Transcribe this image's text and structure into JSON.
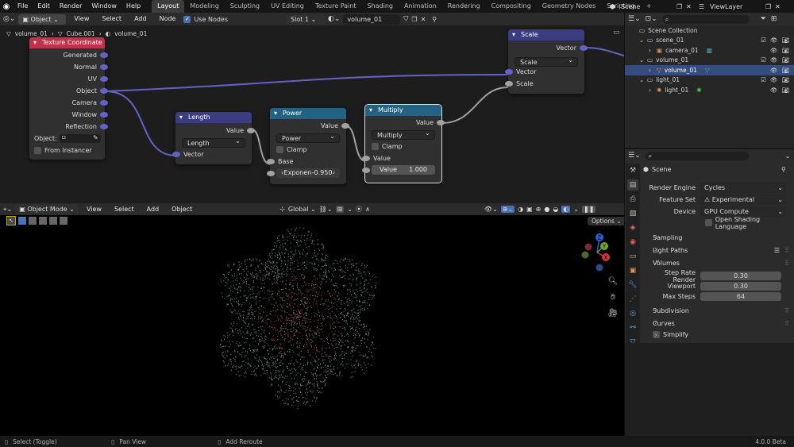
{
  "topbar": {
    "menus": [
      "File",
      "Edit",
      "Render",
      "Window",
      "Help"
    ],
    "workspaces": [
      "Layout",
      "Modeling",
      "Sculpting",
      "UV Editing",
      "Texture Paint",
      "Shading",
      "Animation",
      "Rendering",
      "Compositing",
      "Geometry Nodes",
      "Scripting"
    ],
    "active_workspace": "Layout",
    "add_tab": "+",
    "scene": "Scene",
    "view_layer": "ViewLayer"
  },
  "node_editor": {
    "mode": "Object",
    "menus": [
      "View",
      "Select",
      "Add",
      "Node"
    ],
    "use_nodes_label": "Use Nodes",
    "slot": "Slot 1",
    "material": "volume_01",
    "breadcrumb": [
      "volume_01",
      "Cube.001",
      "volume_01"
    ],
    "texcoord": {
      "title": "Texture Coordinate",
      "outputs": [
        "Generated",
        "Normal",
        "UV",
        "Object",
        "Camera",
        "Window",
        "Reflection"
      ],
      "object_label": "Object:",
      "from_instancer": "From Instancer"
    },
    "length": {
      "title": "Length",
      "output": "Value",
      "op": "Length",
      "input": "Vector"
    },
    "power": {
      "title": "Power",
      "output": "Value",
      "op": "Power",
      "clamp": "Clamp",
      "base": "Base",
      "exponent_label": "Exponen",
      "exponent_value": "-0.950"
    },
    "multiply": {
      "title": "Multiply",
      "output": "Value",
      "op": "Multiply",
      "clamp": "Clamp",
      "value_in": "Value",
      "value_label": "Value",
      "value_value": "1.000"
    },
    "scale": {
      "title": "Scale",
      "output": "Vector",
      "op": "Scale",
      "vector_in": "Vector",
      "scale_in": "Scale"
    }
  },
  "viewport": {
    "mode": "Object Mode",
    "menus": [
      "View",
      "Select",
      "Add",
      "Object"
    ],
    "orientation": "Global",
    "options": "Options",
    "gizmo": {
      "x": "X",
      "y": "Y",
      "z": "Z"
    }
  },
  "outliner": {
    "title": "Scene Collection",
    "items": [
      {
        "name": "scene_01",
        "indent": 1
      },
      {
        "name": "camera_01",
        "indent": 2
      },
      {
        "name": "volume_01",
        "indent": 1
      },
      {
        "name": "volume_01",
        "indent": 2,
        "selected": true
      },
      {
        "name": "light_01",
        "indent": 1
      },
      {
        "name": "light_01",
        "indent": 2
      }
    ]
  },
  "properties": {
    "context": "Scene",
    "render_engine_label": "Render Engine",
    "render_engine": "Cycles",
    "feature_set_label": "Feature Set",
    "feature_set": "Experimental",
    "device_label": "Device",
    "device": "GPU Compute",
    "osl": "Open Shading Language",
    "sections": [
      "Sampling",
      "Light Paths",
      "Volumes",
      "Subdivision",
      "Curves",
      "Simplify"
    ],
    "volumes": {
      "step_rate_render_label": "Step Rate Render",
      "step_rate_render": "0.30",
      "viewport_label": "Viewport",
      "viewport": "0.30",
      "max_steps_label": "Max Steps",
      "max_steps": "64"
    }
  },
  "statusbar": {
    "select": "Select (Toggle)",
    "pan": "Pan View",
    "reroute": "Add Reroute",
    "version": "4.0.0 Beta"
  },
  "colors": {
    "texcoord_header": "#c2314a",
    "vector_header": "#3c3c83",
    "math_header": "#246283",
    "vector_socket": "#6363c7",
    "float_socket": "#a1a1a1",
    "selection": "#334d80"
  }
}
